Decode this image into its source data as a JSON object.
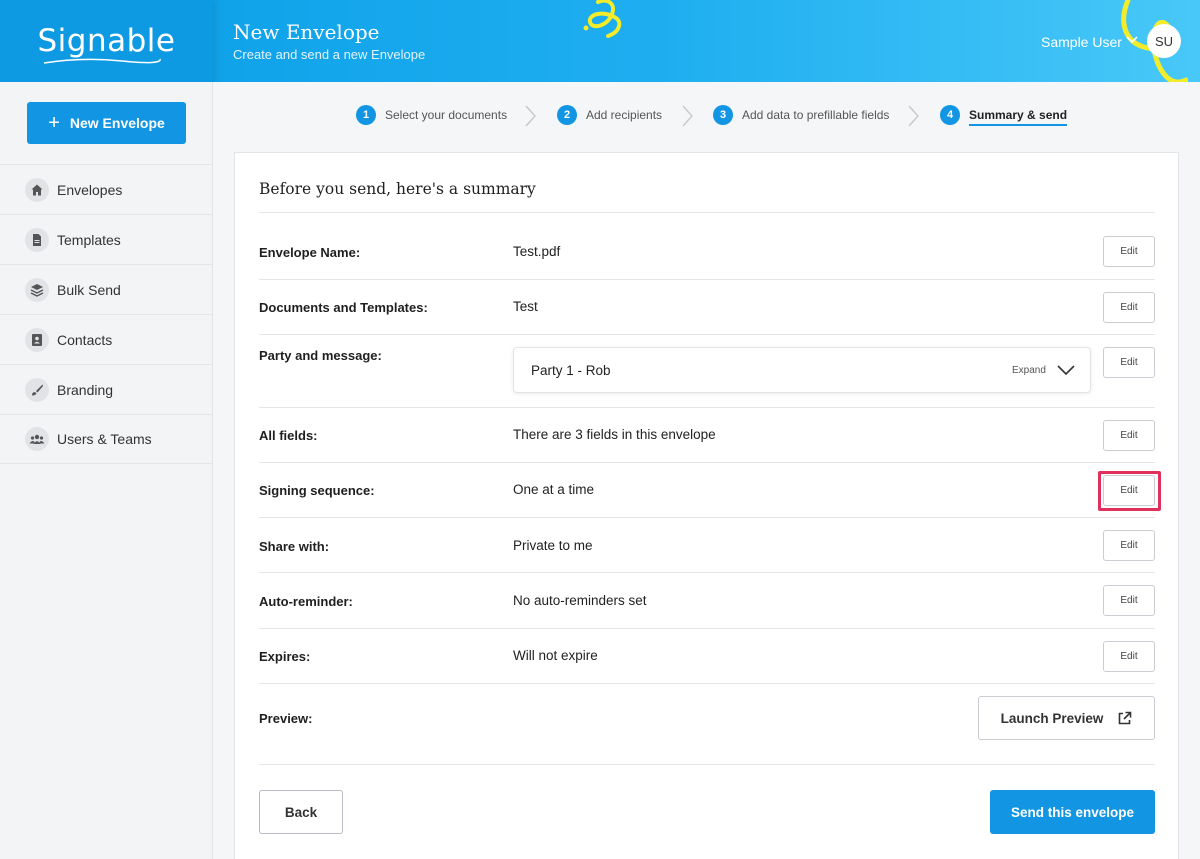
{
  "brand": {
    "logo_text": "Signable"
  },
  "header": {
    "title": "New Envelope",
    "subtitle": "Create and send a new Envelope",
    "user_name": "Sample User",
    "avatar_initials": "SU"
  },
  "sidebar": {
    "new_button_label": "New Envelope",
    "items": [
      {
        "label": "Envelopes",
        "icon": "home-icon"
      },
      {
        "label": "Templates",
        "icon": "document-icon"
      },
      {
        "label": "Bulk Send",
        "icon": "layers-icon"
      },
      {
        "label": "Contacts",
        "icon": "contact-card-icon"
      },
      {
        "label": "Branding",
        "icon": "brush-icon"
      },
      {
        "label": "Users & Teams",
        "icon": "users-icon"
      }
    ]
  },
  "steps": [
    {
      "number": "1",
      "label": "Select your documents"
    },
    {
      "number": "2",
      "label": "Add recipients"
    },
    {
      "number": "3",
      "label": "Add data to prefillable fields"
    },
    {
      "number": "4",
      "label": "Summary & send",
      "active": true
    }
  ],
  "summary": {
    "title": "Before you send, here's a summary",
    "rows": [
      {
        "label": "Envelope Name:",
        "value": "Test.pdf"
      },
      {
        "label": "Documents and Templates:",
        "value": "Test"
      },
      {
        "label": "Party and message:",
        "value": ""
      },
      {
        "label": "All fields:",
        "value": "There are 3 fields in this envelope"
      },
      {
        "label": "Signing sequence:",
        "value": "One at a time"
      },
      {
        "label": "Share with:",
        "value": "Private to me"
      },
      {
        "label": "Auto-reminder:",
        "value": "No auto-reminders set"
      },
      {
        "label": "Expires:",
        "value": "Will not expire"
      },
      {
        "label": "Preview:",
        "value": ""
      }
    ],
    "edit_label": "Edit",
    "party": {
      "name": "Party 1 - Rob",
      "expand_label": "Expand"
    },
    "preview_button": "Launch Preview",
    "back_button": "Back",
    "send_button": "Send this envelope"
  },
  "colors": {
    "primary": "#1296e3",
    "highlight": "#e0315c",
    "squiggle": "#f2ec2b"
  }
}
